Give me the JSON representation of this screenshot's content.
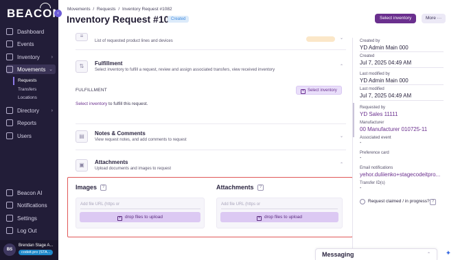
{
  "sidebar": {
    "logo": "BEACON",
    "items": [
      {
        "label": "Dashboard",
        "icon": "dashboard-icon"
      },
      {
        "label": "Events",
        "icon": "calendar-icon"
      },
      {
        "label": "Inventory",
        "icon": "box-icon"
      },
      {
        "label": "Movements",
        "icon": "arrows-icon"
      },
      {
        "label": "Directory",
        "icon": "book-icon"
      },
      {
        "label": "Reports",
        "icon": "reports-icon"
      },
      {
        "label": "Users",
        "icon": "users-icon"
      }
    ],
    "sub_items": [
      "Requests",
      "Transfers",
      "Locations"
    ],
    "bottom_items": [
      {
        "label": "Beacon AI",
        "icon": "sparkle-icon"
      },
      {
        "label": "Notifications",
        "icon": "bell-icon"
      },
      {
        "label": "Settings",
        "icon": "gear-icon"
      },
      {
        "label": "Log Out",
        "icon": "logout-icon"
      }
    ],
    "user": {
      "initials": "BS",
      "name": "Brendan Stage A...",
      "org": "codeit.pro (STA..."
    }
  },
  "header": {
    "breadcrumb": [
      "Movements",
      "/",
      "Requests",
      "/",
      "Inventory Request #1082"
    ],
    "title": "Inventory Request #1082",
    "status": "Created",
    "primary_button": "Select inventory",
    "more_button": "More ···"
  },
  "sections": {
    "line_items": {
      "desc": "List of requested product lines and devices"
    },
    "fulfillment": {
      "title": "Fulfillment",
      "desc": "Select inventory to fulfill a request, review and assign associated transfers, view received inventory",
      "label": "FULFILLMENT",
      "select_button": "Select inventory",
      "link_text": "Select inventory",
      "text_suffix": " to fulfill this request."
    },
    "notes": {
      "title": "Notes & Comments",
      "desc": "View request notes, and add comments to request"
    },
    "attachments": {
      "title": "Attachments",
      "desc": "Upload documents and images to request"
    }
  },
  "upload": {
    "images": {
      "heading": "Images",
      "placeholder": "Add file URL (https or",
      "button": "drop files to upload"
    },
    "attachments": {
      "heading": "Attachments",
      "placeholder": "Add file URL (https or",
      "button": "drop files to upload"
    }
  },
  "details": {
    "created_by_label": "Created by",
    "created_by": "YD Admin Main 000",
    "created_label": "Created",
    "created": "Jul 7, 2025 04:49 AM",
    "modified_by_label": "Last modified by",
    "modified_by": "YD Admin Main 000",
    "modified_label": "Last modified",
    "modified": "Jul 7, 2025 04:49 AM",
    "requested_by_label": "Requested by",
    "requested_by": "YD Sales 11111",
    "manufacturer_label": "Manufacturer",
    "manufacturer": "00 Manufacturer 010725-11",
    "event_label": "Associated event",
    "event": "-",
    "pref_card_label": "Preference card",
    "pref_card": "-",
    "email_label": "Email notifications",
    "email": "yehor.duliienko+stagecodeitpro...",
    "transfer_label": "Transfer ID(s)",
    "transfer": "-",
    "claimed_label": "Request claimed / in progress?"
  },
  "messaging": {
    "title": "Messaging"
  },
  "colors": {
    "primary": "#6a2f8e",
    "sidebar": "#221d38",
    "highlight_border": "#e05656"
  }
}
